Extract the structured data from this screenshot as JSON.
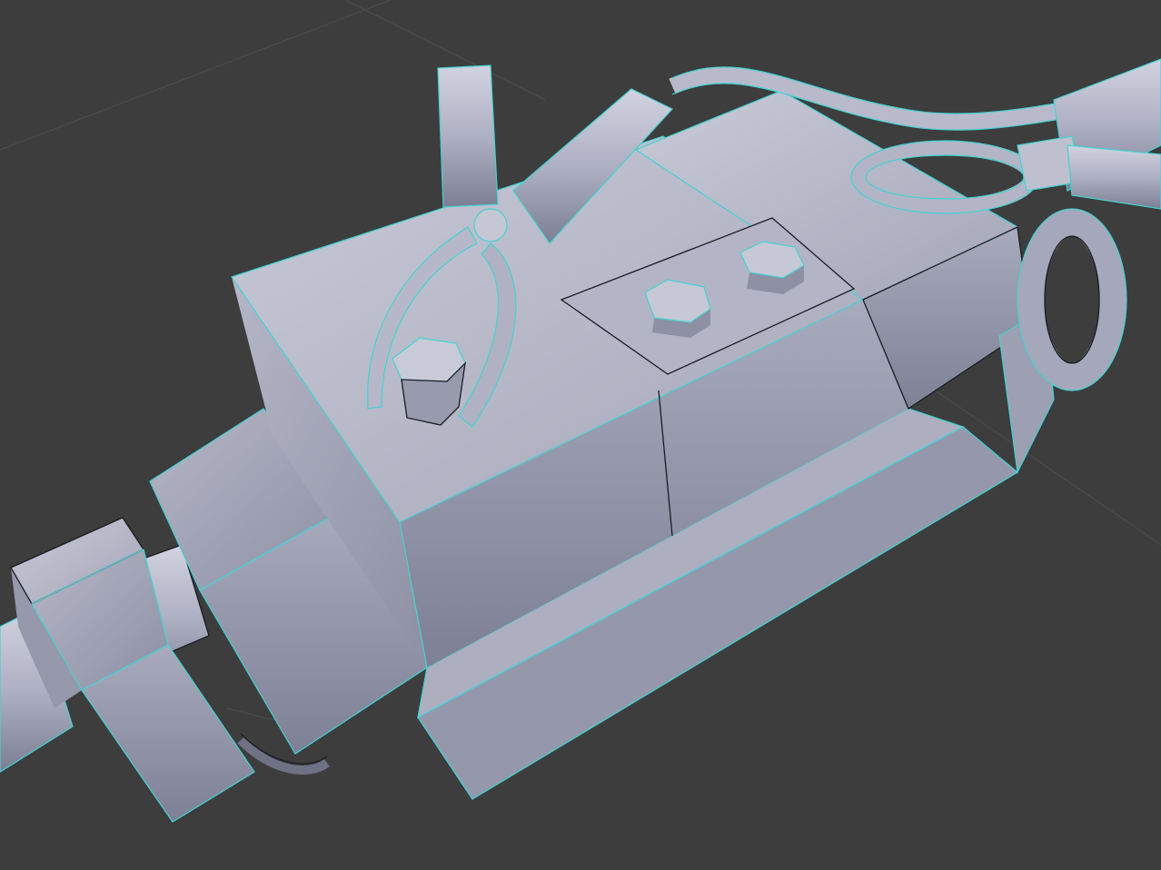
{
  "viewport": {
    "mode": "3d-viewport",
    "shading": "solid",
    "selection": "edit-mode-edges",
    "colors": {
      "background": "#3d3d3d",
      "grid": "#4a4a4a",
      "mesh_light": "#c4c5d4",
      "mesh_mid": "#a9abbe",
      "mesh_dark": "#7f8196",
      "wire_selected": "#43d3d3",
      "wire_unselected": "#1a1c22"
    }
  },
  "objects": [
    {
      "name": "battery-box",
      "kind": "mesh"
    },
    {
      "name": "pliers-left",
      "kind": "mesh"
    },
    {
      "name": "pliers-right",
      "kind": "mesh"
    },
    {
      "name": "hex-bolt-1",
      "kind": "mesh"
    },
    {
      "name": "hex-bolt-2",
      "kind": "mesh"
    },
    {
      "name": "hex-nut",
      "kind": "mesh"
    },
    {
      "name": "cable-left",
      "kind": "mesh"
    },
    {
      "name": "cable-right",
      "kind": "mesh"
    }
  ]
}
